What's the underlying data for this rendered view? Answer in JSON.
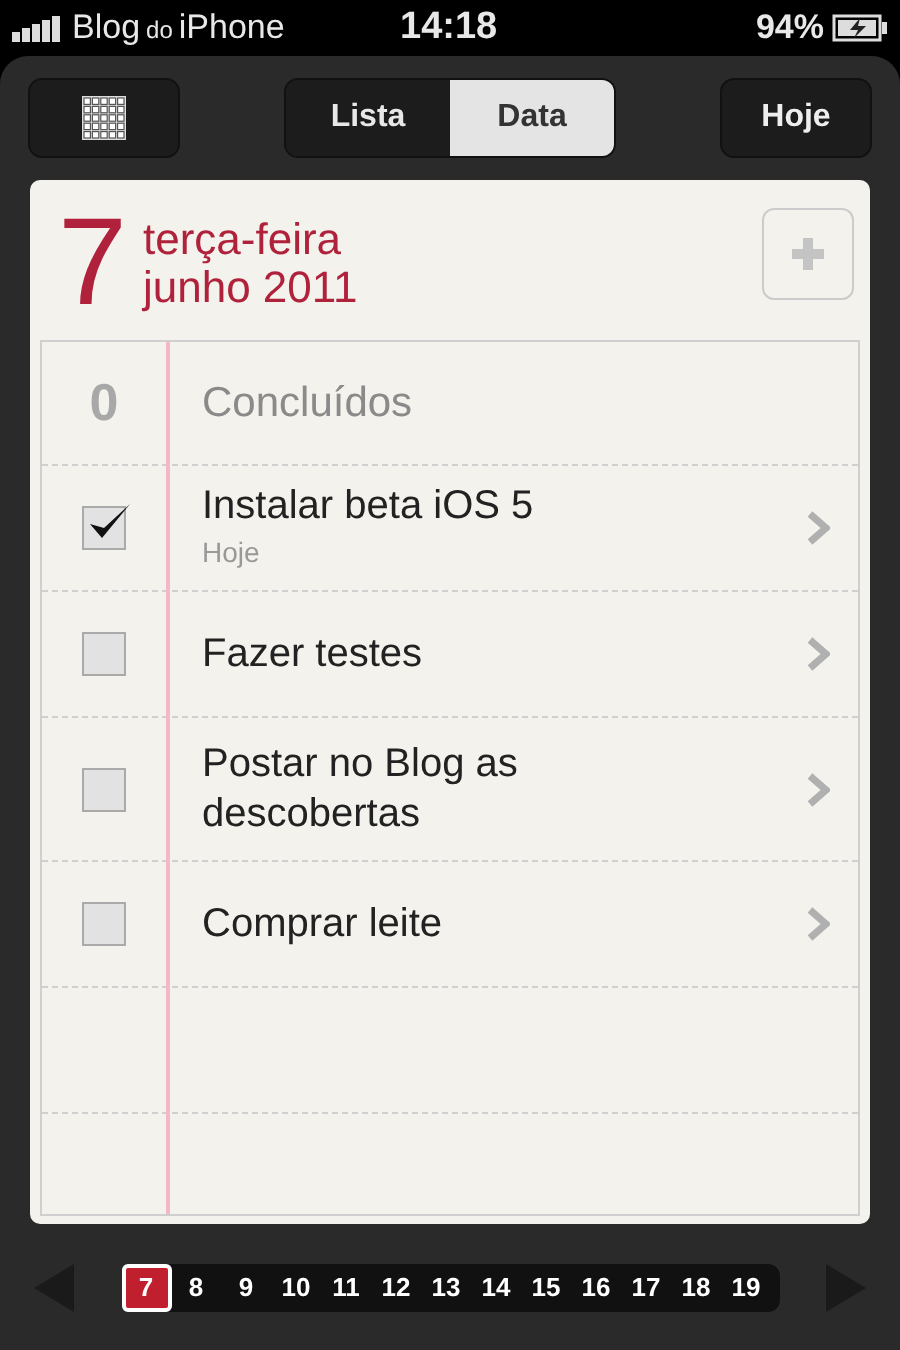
{
  "status_bar": {
    "carrier": [
      "Blog",
      "do",
      "iPhone"
    ],
    "time": "14:18",
    "battery": "94%"
  },
  "toolbar": {
    "segments": [
      {
        "label": "Lista",
        "selected": false
      },
      {
        "label": "Data",
        "selected": true
      }
    ],
    "today_button": "Hoje"
  },
  "date_header": {
    "day": "7",
    "weekday": "terça-feira",
    "month_year": "junho 2011"
  },
  "completed": {
    "count": "0",
    "label": "Concluídos"
  },
  "tasks": [
    {
      "title": "Instalar beta iOS 5",
      "subtitle": "Hoje",
      "checked": true
    },
    {
      "title": "Fazer testes",
      "checked": false
    },
    {
      "title": "Postar no Blog as descobertas",
      "checked": false
    },
    {
      "title": "Comprar leite",
      "checked": false
    }
  ],
  "day_strip": [
    {
      "label": "7",
      "selected": true
    },
    {
      "label": "8",
      "selected": false
    },
    {
      "label": "9",
      "selected": false
    },
    {
      "label": "10",
      "selected": false
    },
    {
      "label": "11",
      "selected": false
    },
    {
      "label": "12",
      "selected": false
    },
    {
      "label": "13",
      "selected": false
    },
    {
      "label": "14",
      "selected": false
    },
    {
      "label": "15",
      "selected": false
    },
    {
      "label": "16",
      "selected": false
    },
    {
      "label": "17",
      "selected": false
    },
    {
      "label": "18",
      "selected": false
    },
    {
      "label": "19",
      "selected": false
    }
  ]
}
